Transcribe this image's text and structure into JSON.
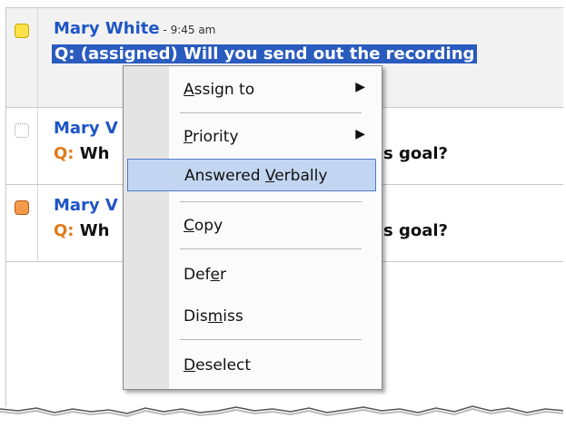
{
  "questions": [
    {
      "author": "Mary White",
      "separator": " - ",
      "time": "9:45 am",
      "question_text": "Q: (assigned) Will you send out the recording",
      "flag_color": "#ffe24a",
      "selected": true
    },
    {
      "author": "Mary V",
      "question_label": "Q:",
      "question_text": " Wh",
      "question_tail": "s goal?",
      "flag_color": "none",
      "selected": false
    },
    {
      "author": "Mary V",
      "question_label": "Q:",
      "question_text": " Wh",
      "question_tail": "s goal?",
      "flag_color": "#f59a4a",
      "selected": false
    }
  ],
  "context_menu": {
    "items": [
      {
        "pre": "",
        "key": "A",
        "post": "ssign to",
        "submenu": true,
        "submenu_arrow": "▶"
      },
      {
        "pre": "",
        "key": "P",
        "post": "riority",
        "submenu": true,
        "submenu_arrow": "▶"
      },
      {
        "pre": "Answered ",
        "key": "V",
        "post": "erbally",
        "highlighted": true
      },
      {
        "pre": "",
        "key": "C",
        "post": "opy"
      },
      {
        "pre": "Def",
        "key": "e",
        "post": "r"
      },
      {
        "pre": "Dis",
        "key": "m",
        "post": "iss"
      },
      {
        "pre": "",
        "key": "D",
        "post": "eselect"
      }
    ]
  },
  "colors": {
    "author": "#1f55c6",
    "question_label": "#e07a1a",
    "selection": "#2a5bbf",
    "menu_highlight": "#c3d6f1"
  }
}
